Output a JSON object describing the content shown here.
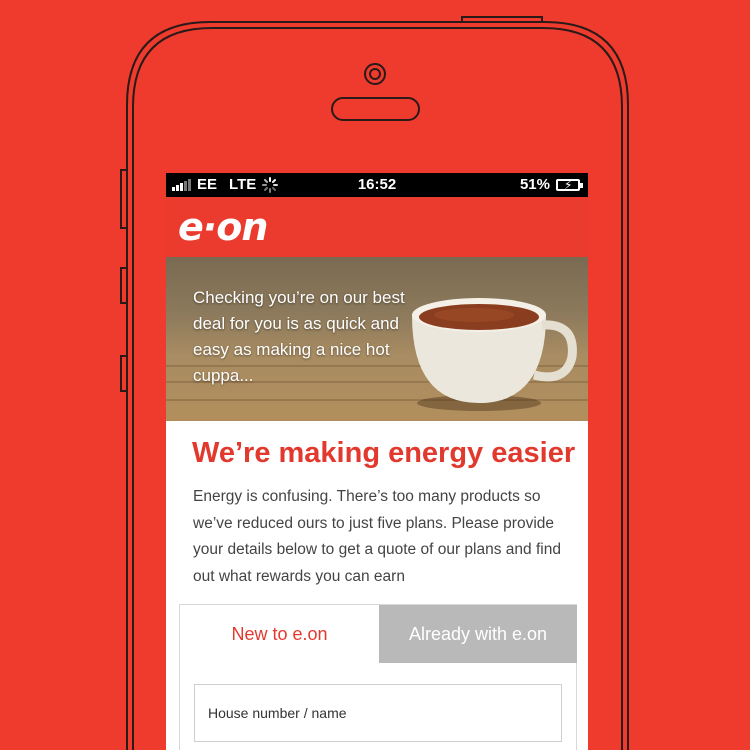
{
  "status_bar": {
    "carrier": "EE",
    "network": "LTE",
    "time": "16:52",
    "battery": "51%"
  },
  "brand": {
    "logo_text": "e·on",
    "color": "#ea3b2e"
  },
  "hero": {
    "caption": "Checking you’re on our best deal for you is as quick and easy as making a nice hot cuppa..."
  },
  "main": {
    "headline": "We’re making energy easier",
    "intro": "Energy is confusing. There’s too many products so we’ve reduced ours to just five plans. Please provide your details below to get a quote of our plans and find out what rewards you can earn"
  },
  "tabs": [
    {
      "label": "New to e.on",
      "active": true
    },
    {
      "label": "Already with e.on",
      "active": false
    }
  ],
  "form": {
    "house_placeholder": "House number / name"
  },
  "colors": {
    "background": "#ee3b2e",
    "accent": "#e2392e",
    "inactive_tab": "#b9b9b9"
  }
}
